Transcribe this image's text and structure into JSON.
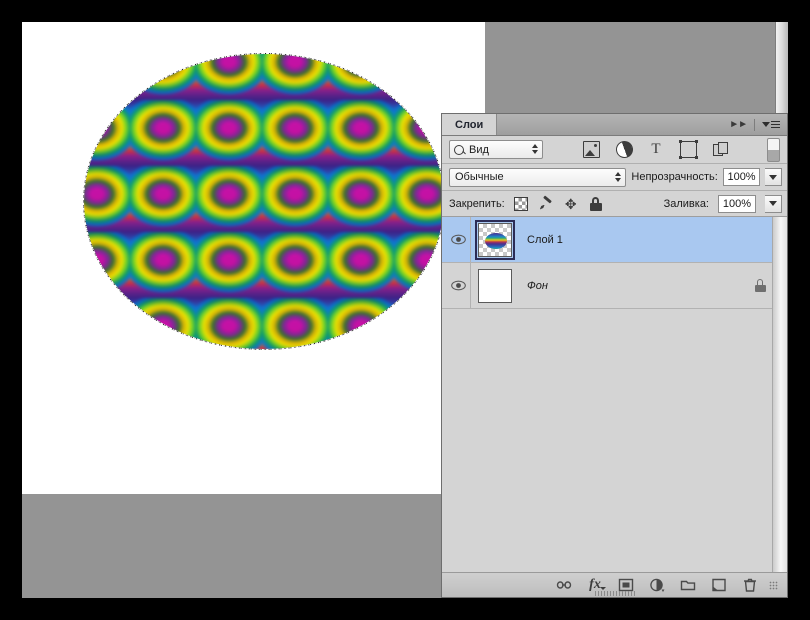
{
  "window": {
    "background_color": "#000000",
    "workspace_color": "#949494",
    "canvas_color": "#ffffff"
  },
  "canvas": {
    "name": "document-canvas",
    "selection": "elliptical-marquee",
    "pattern_description": "repeating radial rainbow pattern"
  },
  "panel": {
    "title": "Слои",
    "collapse_icon": "double-chevron-right-icon",
    "menu_icon": "panel-menu-icon",
    "filter": {
      "kind_label": "Вид",
      "search_icon": "search-icon",
      "stepper_icon": "stepper-updown-icon",
      "icons": [
        {
          "name": "filter-pixel-layers-icon",
          "title": "image-icon"
        },
        {
          "name": "filter-adjustment-layers-icon",
          "title": "adjustment-icon"
        },
        {
          "name": "filter-type-layers-icon",
          "title": "text-icon"
        },
        {
          "name": "filter-shape-layers-icon",
          "title": "shape-icon"
        },
        {
          "name": "filter-smart-objects-icon",
          "title": "smart-object-icon"
        }
      ],
      "toggle_name": "filter-enable-toggle"
    },
    "blend": {
      "mode": "Обычные",
      "opacity_label": "Непрозрачность:",
      "opacity_value": "100%",
      "fill_label": "Заливка:",
      "fill_value": "100%"
    },
    "lock": {
      "label": "Закрепить:",
      "icons": [
        {
          "name": "lock-transparent-pixels-icon"
        },
        {
          "name": "lock-image-pixels-icon"
        },
        {
          "name": "lock-position-icon"
        },
        {
          "name": "lock-all-icon"
        }
      ]
    },
    "layers": [
      {
        "name": "Слой 1",
        "selected": true,
        "visible": true,
        "locked": false,
        "italic": false,
        "thumb": "pattern"
      },
      {
        "name": "Фон",
        "selected": false,
        "visible": true,
        "locked": true,
        "italic": true,
        "thumb": "white"
      }
    ],
    "bottom_bar": [
      {
        "name": "link-layers-button",
        "glyph": "link-icon"
      },
      {
        "name": "layer-style-button",
        "glyph": "fx-icon",
        "label": "fx"
      },
      {
        "name": "add-layer-mask-button",
        "glyph": "mask-icon"
      },
      {
        "name": "new-adjustment-layer-button",
        "glyph": "adjustment-icon"
      },
      {
        "name": "new-group-button",
        "glyph": "folder-icon"
      },
      {
        "name": "new-layer-button",
        "glyph": "new-layer-icon"
      },
      {
        "name": "delete-layer-button",
        "glyph": "trash-icon"
      }
    ],
    "selection_color": "#a9c8f0",
    "panel_bg": "#d4d4d4"
  }
}
